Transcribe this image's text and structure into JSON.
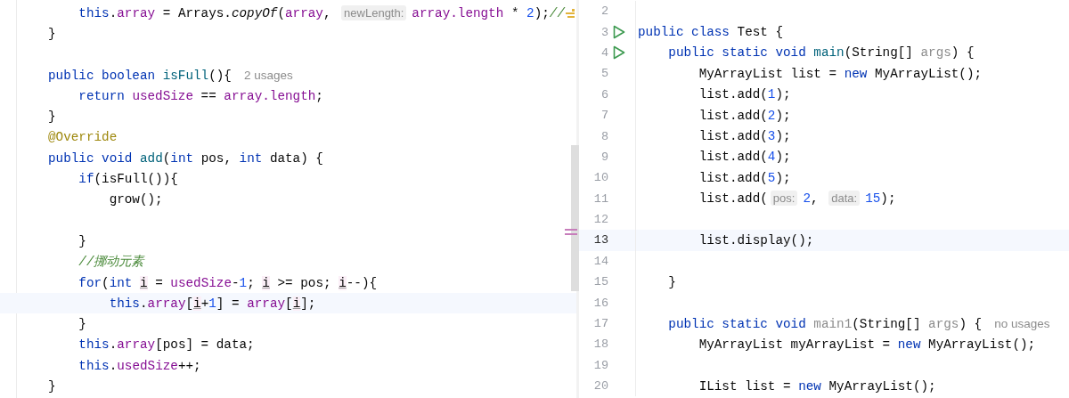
{
  "left_editor": {
    "lines": [
      {
        "current": false,
        "tokens": [
          {
            "kind": "kw",
            "text": "    this"
          },
          {
            "kind": "plain",
            "text": "."
          },
          {
            "kind": "field",
            "text": "array"
          },
          {
            "kind": "plain",
            "text": " = Arrays."
          },
          {
            "kind": "italic",
            "text": "copyOf"
          },
          {
            "kind": "plain",
            "text": "("
          },
          {
            "kind": "field",
            "text": "array"
          },
          {
            "kind": "plain",
            "text": ", "
          },
          {
            "kind": "hint",
            "text": "newLength:"
          },
          {
            "kind": "field",
            "text": "array.length"
          },
          {
            "kind": "plain",
            "text": " * "
          },
          {
            "kind": "num",
            "text": "2"
          },
          {
            "kind": "plain",
            "text": ");"
          },
          {
            "kind": "comment",
            "text": "//"
          },
          {
            "kind": "marker"
          }
        ]
      },
      {
        "current": false,
        "tokens": [
          {
            "kind": "plain",
            "text": "}"
          }
        ]
      },
      {
        "current": false
      },
      {
        "current": false,
        "tokens": [
          {
            "kind": "kw",
            "text": "public boolean "
          },
          {
            "kind": "decl",
            "text": "isFull"
          },
          {
            "kind": "plain",
            "text": "(){"
          },
          {
            "kind": "usage",
            "text": "2 usages"
          }
        ]
      },
      {
        "current": false,
        "tokens": [
          {
            "kind": "kw",
            "text": "    return "
          },
          {
            "kind": "field",
            "text": "usedSize"
          },
          {
            "kind": "plain",
            "text": " == "
          },
          {
            "kind": "field",
            "text": "array.length"
          },
          {
            "kind": "plain",
            "text": ";"
          }
        ]
      },
      {
        "current": false,
        "tokens": [
          {
            "kind": "plain",
            "text": "}"
          }
        ]
      },
      {
        "current": false,
        "tokens": [
          {
            "kind": "annot",
            "text": "@Override"
          }
        ]
      },
      {
        "current": false,
        "tokens": [
          {
            "kind": "kw",
            "text": "public void "
          },
          {
            "kind": "decl",
            "text": "add"
          },
          {
            "kind": "plain",
            "text": "("
          },
          {
            "kind": "kw",
            "text": "int"
          },
          {
            "kind": "plain",
            "text": " pos, "
          },
          {
            "kind": "kw",
            "text": "int"
          },
          {
            "kind": "plain",
            "text": " data) {"
          }
        ]
      },
      {
        "current": false,
        "tokens": [
          {
            "kind": "kw",
            "text": "    if"
          },
          {
            "kind": "plain",
            "text": "(isFull()){"
          }
        ]
      },
      {
        "current": false,
        "tokens": [
          {
            "kind": "plain",
            "text": "        grow();"
          }
        ]
      },
      {
        "current": false
      },
      {
        "current": false,
        "tokens": [
          {
            "kind": "plain",
            "text": "    }"
          }
        ]
      },
      {
        "current": false,
        "tokens": [
          {
            "kind": "comment",
            "text": "    //挪动元素"
          }
        ]
      },
      {
        "current": false,
        "tokens": [
          {
            "kind": "kw",
            "text": "    for"
          },
          {
            "kind": "plain",
            "text": "("
          },
          {
            "kind": "kw",
            "text": "int "
          },
          {
            "kind": "ivar",
            "text": "i"
          },
          {
            "kind": "plain",
            "text": " = "
          },
          {
            "kind": "field",
            "text": "usedSize"
          },
          {
            "kind": "plain",
            "text": "-"
          },
          {
            "kind": "num",
            "text": "1"
          },
          {
            "kind": "plain",
            "text": "; "
          },
          {
            "kind": "ivar",
            "text": "i"
          },
          {
            "kind": "plain",
            "text": " >= pos; "
          },
          {
            "kind": "ivar",
            "text": "i"
          },
          {
            "kind": "plain",
            "text": "--){"
          }
        ]
      },
      {
        "current": true,
        "tokens": [
          {
            "kind": "kw",
            "text": "        this"
          },
          {
            "kind": "plain",
            "text": "."
          },
          {
            "kind": "field",
            "text": "array"
          },
          {
            "kind": "plain",
            "text": "["
          },
          {
            "kind": "ivar",
            "text": "i"
          },
          {
            "kind": "plain",
            "text": "+"
          },
          {
            "kind": "num",
            "text": "1"
          },
          {
            "kind": "plain",
            "text": "] = "
          },
          {
            "kind": "field",
            "text": "array"
          },
          {
            "kind": "plain",
            "text": "["
          },
          {
            "kind": "ivar",
            "text": "i"
          },
          {
            "kind": "plain",
            "text": "];"
          }
        ]
      },
      {
        "current": false,
        "tokens": [
          {
            "kind": "plain",
            "text": "    }"
          }
        ]
      },
      {
        "current": false,
        "tokens": [
          {
            "kind": "kw",
            "text": "    this"
          },
          {
            "kind": "plain",
            "text": "."
          },
          {
            "kind": "field",
            "text": "array"
          },
          {
            "kind": "plain",
            "text": "[pos] = data;"
          }
        ]
      },
      {
        "current": false,
        "tokens": [
          {
            "kind": "kw",
            "text": "    this"
          },
          {
            "kind": "plain",
            "text": "."
          },
          {
            "kind": "field",
            "text": "usedSize"
          },
          {
            "kind": "plain",
            "text": "++;"
          }
        ]
      },
      {
        "current": false,
        "tokens": [
          {
            "kind": "plain",
            "text": "}"
          }
        ]
      }
    ]
  },
  "right_editor": {
    "lines": [
      {
        "number": "2",
        "run_button": false,
        "current": false
      },
      {
        "number": "3",
        "run_button": true,
        "current": false,
        "tokens": [
          {
            "kind": "kw",
            "text": "public class "
          },
          {
            "kind": "plain",
            "text": "Test {"
          }
        ]
      },
      {
        "number": "4",
        "run_button": true,
        "current": false,
        "tokens": [
          {
            "kind": "kw",
            "text": "    public static void "
          },
          {
            "kind": "decl",
            "text": "main"
          },
          {
            "kind": "plain",
            "text": "(String[] "
          },
          {
            "kind": "unused",
            "text": "args"
          },
          {
            "kind": "plain",
            "text": ") {"
          }
        ]
      },
      {
        "number": "5",
        "run_button": false,
        "current": false,
        "tokens": [
          {
            "kind": "plain",
            "text": "        MyArrayList list = "
          },
          {
            "kind": "kw",
            "text": "new"
          },
          {
            "kind": "plain",
            "text": " MyArrayList();"
          }
        ]
      },
      {
        "number": "6",
        "run_button": false,
        "current": false,
        "tokens": [
          {
            "kind": "plain",
            "text": "        list.add("
          },
          {
            "kind": "num",
            "text": "1"
          },
          {
            "kind": "plain",
            "text": ");"
          }
        ]
      },
      {
        "number": "7",
        "run_button": false,
        "current": false,
        "tokens": [
          {
            "kind": "plain",
            "text": "        list.add("
          },
          {
            "kind": "num",
            "text": "2"
          },
          {
            "kind": "plain",
            "text": ");"
          }
        ]
      },
      {
        "number": "8",
        "run_button": false,
        "current": false,
        "tokens": [
          {
            "kind": "plain",
            "text": "        list.add("
          },
          {
            "kind": "num",
            "text": "3"
          },
          {
            "kind": "plain",
            "text": ");"
          }
        ]
      },
      {
        "number": "9",
        "run_button": false,
        "current": false,
        "tokens": [
          {
            "kind": "plain",
            "text": "        list.add("
          },
          {
            "kind": "num",
            "text": "4"
          },
          {
            "kind": "plain",
            "text": ");"
          }
        ]
      },
      {
        "number": "10",
        "run_button": false,
        "current": false,
        "tokens": [
          {
            "kind": "plain",
            "text": "        list.add("
          },
          {
            "kind": "num",
            "text": "5"
          },
          {
            "kind": "plain",
            "text": ");"
          }
        ]
      },
      {
        "number": "11",
        "run_button": false,
        "current": false,
        "tokens": [
          {
            "kind": "plain",
            "text": "        list.add("
          },
          {
            "kind": "hint",
            "text": "pos:"
          },
          {
            "kind": "num",
            "text": "2"
          },
          {
            "kind": "plain",
            "text": ", "
          },
          {
            "kind": "hint",
            "text": "data:"
          },
          {
            "kind": "num",
            "text": "15"
          },
          {
            "kind": "plain",
            "text": ");"
          }
        ]
      },
      {
        "number": "12",
        "run_button": false,
        "current": false
      },
      {
        "number": "13",
        "run_button": false,
        "current": true,
        "tokens": [
          {
            "kind": "plain",
            "text": "        list.display();"
          }
        ]
      },
      {
        "number": "14",
        "run_button": false,
        "current": false
      },
      {
        "number": "15",
        "run_button": false,
        "current": false,
        "tokens": [
          {
            "kind": "plain",
            "text": "    }"
          }
        ]
      },
      {
        "number": "16",
        "run_button": false,
        "current": false
      },
      {
        "number": "17",
        "run_button": false,
        "current": false,
        "tokens": [
          {
            "kind": "kw",
            "text": "    public static void "
          },
          {
            "kind": "unused",
            "text": "main1"
          },
          {
            "kind": "plain",
            "text": "(String[] "
          },
          {
            "kind": "unused",
            "text": "args"
          },
          {
            "kind": "plain",
            "text": ") {"
          },
          {
            "kind": "usage",
            "text": "no usages"
          }
        ]
      },
      {
        "number": "18",
        "run_button": false,
        "current": false,
        "tokens": [
          {
            "kind": "plain",
            "text": "        MyArrayList myArrayList = "
          },
          {
            "kind": "kw",
            "text": "new"
          },
          {
            "kind": "plain",
            "text": " MyArrayList();"
          }
        ]
      },
      {
        "number": "19",
        "run_button": false,
        "current": false
      },
      {
        "number": "20",
        "run_button": false,
        "current": false,
        "tokens": [
          {
            "kind": "plain",
            "text": "        IList list = "
          },
          {
            "kind": "kw",
            "text": "new"
          },
          {
            "kind": "plain",
            "text": " MyArrayList();"
          }
        ]
      }
    ]
  }
}
